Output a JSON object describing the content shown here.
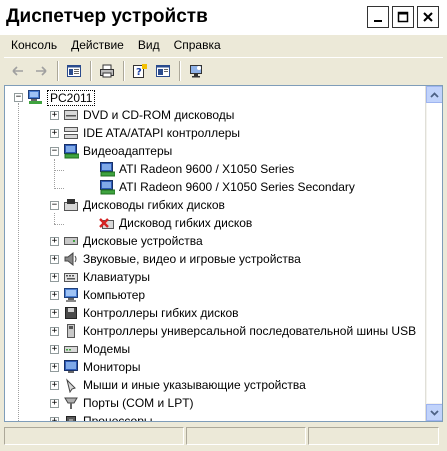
{
  "window": {
    "title": "Диспетчер устройств",
    "buttons": {
      "minimize": "_",
      "maximize": "□",
      "close": "✕"
    }
  },
  "menu": [
    "Консоль",
    "Действие",
    "Вид",
    "Справка"
  ],
  "toolbar": {
    "icons": [
      "back-arrow-icon",
      "forward-arrow-icon",
      "console-tree-icon",
      "print-icon",
      "help-properties-icon",
      "properties-icon",
      "scan-hardware-icon"
    ]
  },
  "tree": {
    "root": "PC2011",
    "nodes": [
      {
        "label": "DVD и CD-ROM дисководы",
        "icon": "cdrom-icon",
        "expanded": false
      },
      {
        "label": "IDE ATA/ATAPI контроллеры",
        "icon": "ide-controller-icon",
        "expanded": false
      },
      {
        "label": "Видеоадаптеры",
        "icon": "display-adapter-icon",
        "expanded": true,
        "children": [
          {
            "label": "ATI Radeon 9600 / X1050 Series",
            "icon": "display-adapter-icon"
          },
          {
            "label": "ATI Radeon 9600 / X1050 Series Secondary",
            "icon": "display-adapter-icon"
          }
        ]
      },
      {
        "label": "Дисководы гибких дисков",
        "icon": "floppy-drive-icon",
        "expanded": true,
        "children": [
          {
            "label": "Дисковод гибких дисков",
            "icon": "disabled-floppy-icon"
          }
        ]
      },
      {
        "label": "Дисковые устройства",
        "icon": "disk-drive-icon",
        "expanded": false
      },
      {
        "label": "Звуковые, видео и игровые устройства",
        "icon": "sound-icon",
        "expanded": false
      },
      {
        "label": "Клавиатуры",
        "icon": "keyboard-icon",
        "expanded": false
      },
      {
        "label": "Компьютер",
        "icon": "computer-icon",
        "expanded": false
      },
      {
        "label": "Контроллеры гибких дисков",
        "icon": "floppy-controller-icon",
        "expanded": false
      },
      {
        "label": "Контроллеры универсальной последовательной шины USB",
        "icon": "usb-icon",
        "expanded": false
      },
      {
        "label": "Модемы",
        "icon": "modem-icon",
        "expanded": false
      },
      {
        "label": "Мониторы",
        "icon": "monitor-icon",
        "expanded": false
      },
      {
        "label": "Мыши и иные указывающие устройства",
        "icon": "mouse-icon",
        "expanded": false
      },
      {
        "label": "Порты (COM и LPT)",
        "icon": "port-icon",
        "expanded": false
      },
      {
        "label": "Процессоры",
        "icon": "processor-icon",
        "expanded": false
      }
    ]
  },
  "colors": {
    "tree_lines": "#A0A0A0",
    "error_x": "#D42222",
    "scrollbar": "#C1D3FB"
  }
}
